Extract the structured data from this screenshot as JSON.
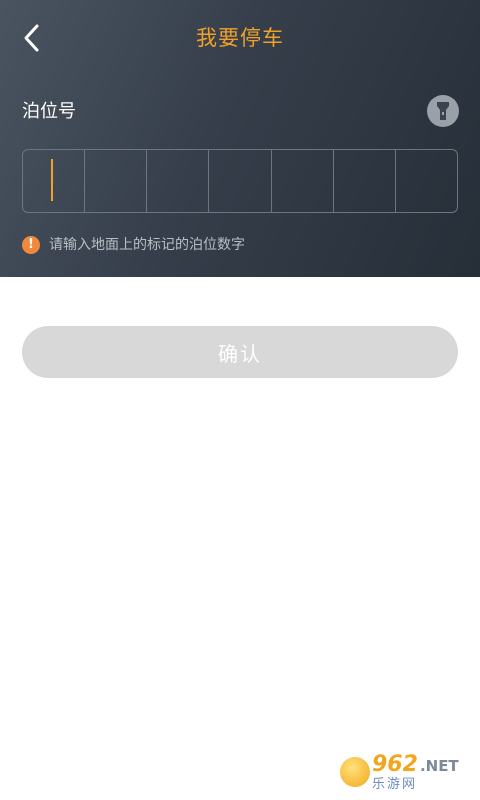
{
  "header": {
    "title": "我要停车"
  },
  "form": {
    "label": "泊位号",
    "cells": [
      "",
      "",
      "",
      "",
      "",
      "",
      ""
    ],
    "hint": "请输入地面上的标记的泊位数字",
    "hint_icon": "!"
  },
  "actions": {
    "confirm_label": "确认"
  },
  "watermark": {
    "main": "962",
    "suffix": ".NET",
    "sub": "乐游网"
  },
  "colors": {
    "accent": "#f0a12a",
    "warning": "#f08a3a",
    "disabled_button": "#d8d8d8"
  },
  "icons": {
    "back": "chevron-left-icon",
    "flashlight": "flashlight-icon",
    "warning": "warning-icon"
  }
}
